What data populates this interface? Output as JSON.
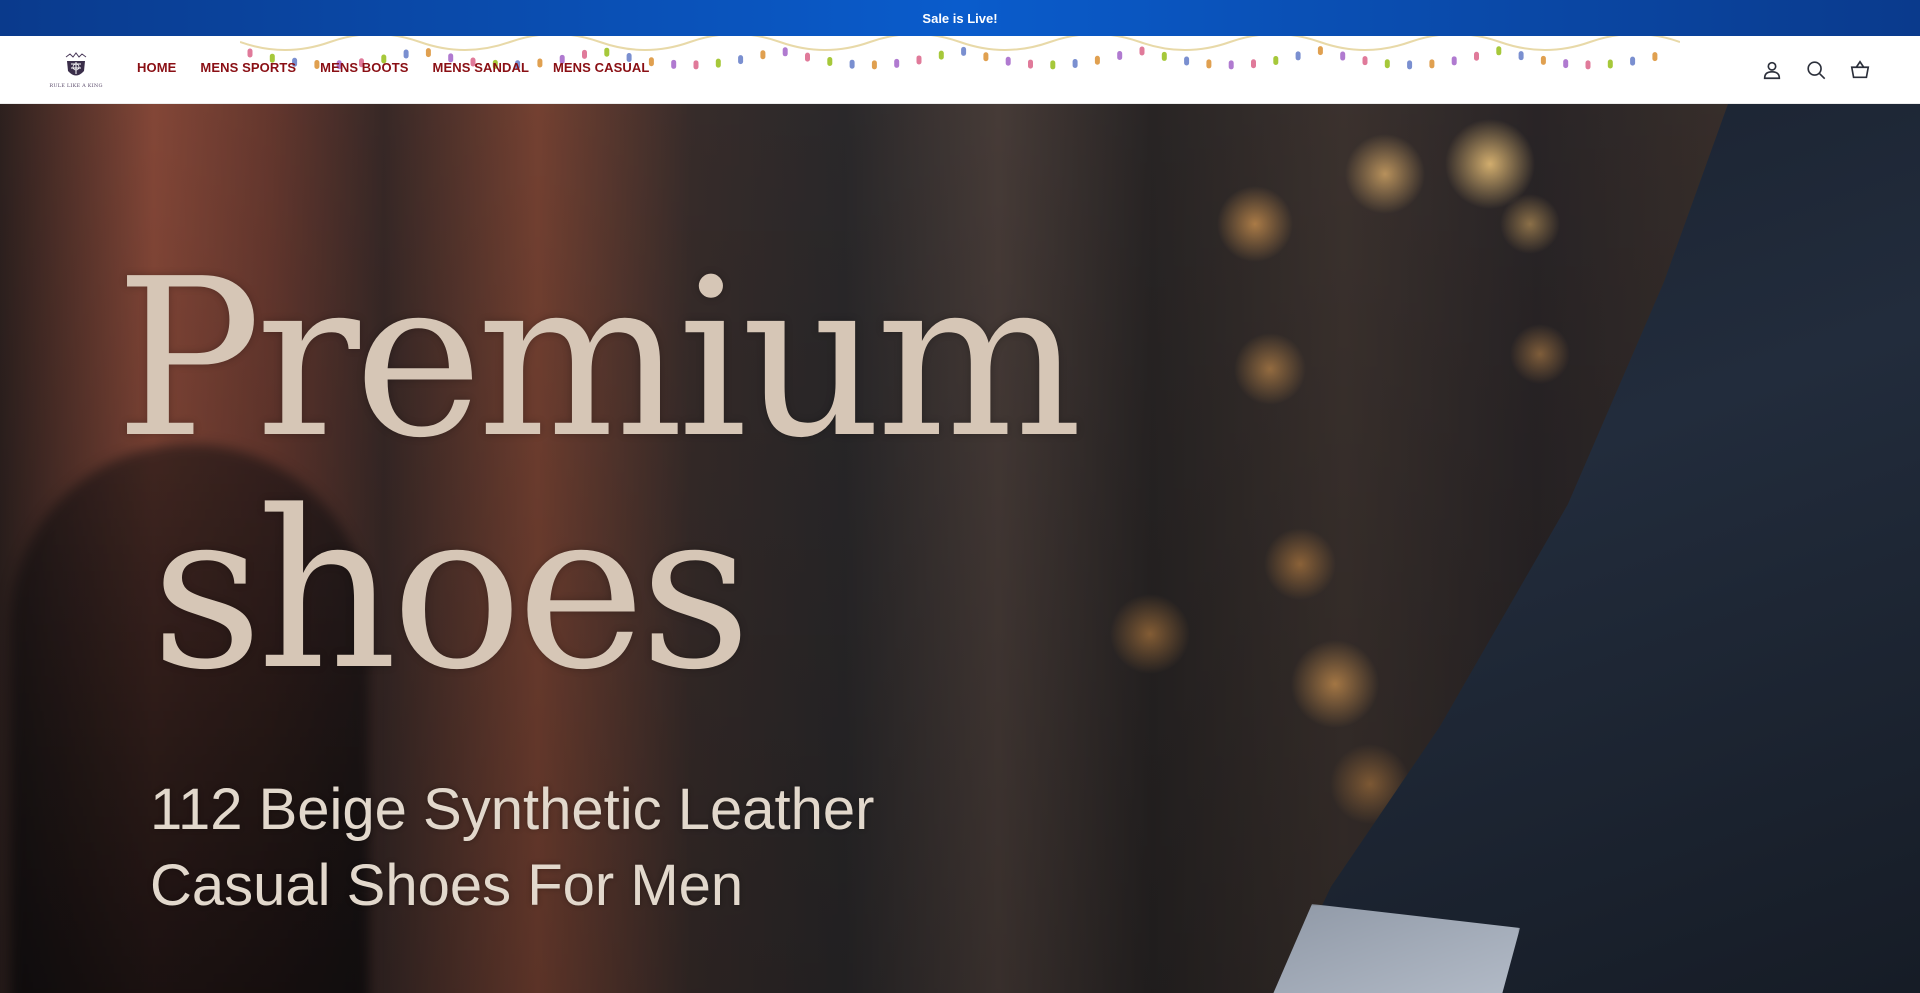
{
  "announcement": {
    "text": "Sale is Live!"
  },
  "header": {
    "logo": {
      "caption": "RULE LIKE A KING"
    },
    "nav": [
      "HOME",
      "MENS SPORTS",
      "MENS BOOTS",
      "MENS SANDAL",
      "MENS CASUAL"
    ],
    "icons": [
      "account-icon",
      "search-icon",
      "cart-icon"
    ]
  },
  "hero": {
    "title_line1": "Premium",
    "title_line2": "shoes",
    "subtitle_line1": "112 Beige Synthetic Leather",
    "subtitle_line2": "Casual Shoes For Men"
  },
  "colors": {
    "announcement_bg": "#0a5ccc",
    "nav_text": "#8a0f14",
    "hero_title": "#d6c6b6"
  }
}
